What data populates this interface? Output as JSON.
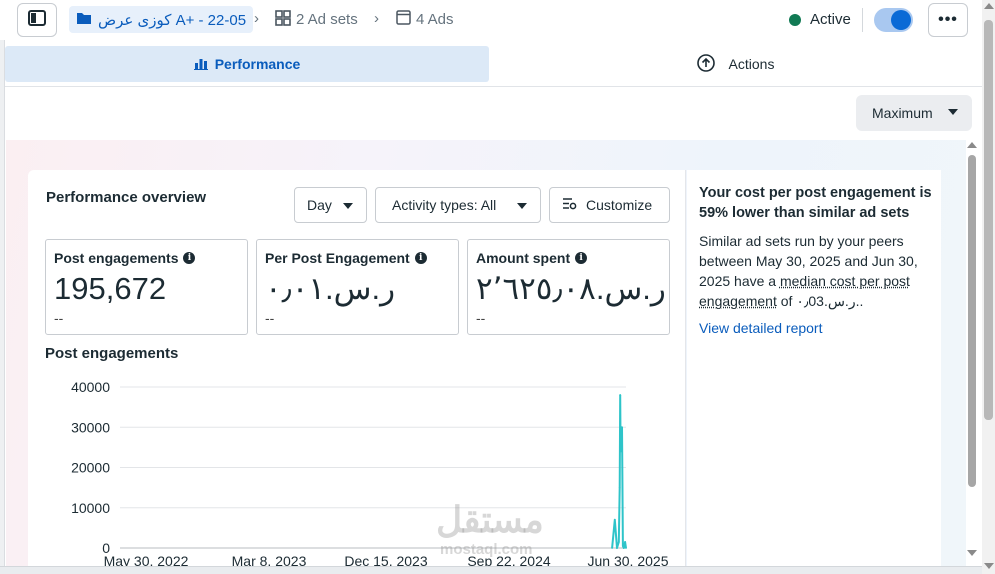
{
  "header": {
    "campaign_name": "کوزی عرض A+ - 22-05",
    "ad_sets": "2 Ad sets",
    "ads": "4 Ads",
    "status": "Active",
    "status_color": "#117a54",
    "more_label": "•••",
    "icons": [
      "sidebar-toggle-icon",
      "folder-icon",
      "grid-icon",
      "ad-icon",
      "more-icon"
    ]
  },
  "tabs": {
    "performance": "Performance",
    "actions": "Actions"
  },
  "view_select": {
    "label": "Maximum"
  },
  "overview": {
    "title": "Performance overview",
    "period": "Day",
    "activity_filter": "Activity types: All",
    "customize": "Customize"
  },
  "metrics": [
    {
      "label": "Post engagements",
      "value": "195,672",
      "compare": "--"
    },
    {
      "label": "Per Post Engagement",
      "value": "ر.س.٠٫٠١",
      "compare": "--"
    },
    {
      "label": "Amount spent",
      "value": "ر.س.٢٬٦٢٥٫٠٨",
      "compare": "--"
    }
  ],
  "chart": {
    "title": "Post engagements"
  },
  "chart_data": {
    "type": "line",
    "title": "Post engagements",
    "xlabel": "",
    "ylabel": "",
    "x_ticks": [
      "May 30, 2022",
      "Mar 8, 2023",
      "Dec 15, 2023",
      "Sep 22, 2024",
      "Jun 30, 2025"
    ],
    "y_ticks": [
      40000,
      30000,
      20000,
      10000,
      0
    ],
    "ylim": [
      0,
      40000
    ],
    "series": [
      {
        "color": "#2ec4c9",
        "x": [
          "2025-05-30",
          "2025-06-05",
          "2025-06-10",
          "2025-06-14",
          "2025-06-16",
          "2025-06-17",
          "2025-06-18",
          "2025-06-19",
          "2025-06-21",
          "2025-06-23",
          "2025-06-25",
          "2025-06-28",
          "2025-06-30"
        ],
        "values": [
          0,
          7000,
          0,
          1500,
          15000,
          38000,
          24000,
          29000,
          30000,
          500,
          0,
          1500,
          0
        ]
      }
    ],
    "grid": true,
    "legend": "none"
  },
  "insight": {
    "headline": "Your cost per post engagement is 59% lower than similar ad sets",
    "body_before": "Similar ad sets run by your peers between May 30, 2025 and Jun 30, 2025 have a ",
    "body_underlined": "median cost per post engagement",
    "body_after": " of ر.س.٠٫03..",
    "link": "View detailed report"
  },
  "watermark": {
    "main": "مستقل",
    "sub": "mostaql.com"
  }
}
